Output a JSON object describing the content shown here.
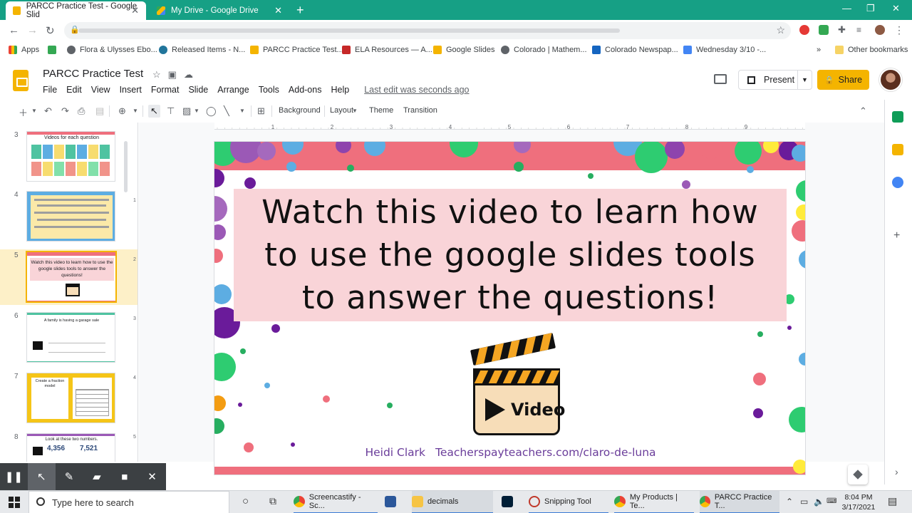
{
  "browser": {
    "tabs": [
      {
        "label": "PARCC Practice Test - Google Slid",
        "active": true
      },
      {
        "label": "My Drive - Google Drive",
        "active": false
      }
    ],
    "bookmarks": [
      "Apps",
      "Flora & Ulysses Ebo...",
      "Released Items - N...",
      "PARCC Practice Test...",
      "ELA Resources — A...",
      "Google Slides",
      "Colorado | Mathem...",
      "Colorado Newspap...",
      "Wednesday 3/10 -...",
      "Other bookmarks"
    ],
    "bookmarks_more": "»"
  },
  "app": {
    "title": "PARCC Practice Test",
    "menu": [
      "File",
      "Edit",
      "View",
      "Insert",
      "Format",
      "Slide",
      "Arrange",
      "Tools",
      "Add-ons",
      "Help"
    ],
    "last_edit": "Last edit was seconds ago",
    "present_label": "Present",
    "share_label": "Share"
  },
  "toolbar": {
    "background": "Background",
    "layout": "Layout",
    "theme": "Theme",
    "transition": "Transition"
  },
  "filmstrip": {
    "slides": [
      {
        "number": "3",
        "caption": "Videos for each question"
      },
      {
        "number": "4",
        "caption": ""
      },
      {
        "number": "5",
        "caption": "Watch this video to learn how to use the google slides tools to answer the questions!"
      },
      {
        "number": "6",
        "caption": "A family is having a garage sale"
      },
      {
        "number": "7",
        "caption": "Create a fraction model"
      },
      {
        "number": "8",
        "caption": "Look at these two numbers."
      }
    ],
    "slide8_numbers": [
      "4,356",
      "7,521"
    ],
    "selected": "5"
  },
  "ruler": {
    "marks": [
      "1",
      "2",
      "3",
      "4",
      "5",
      "6",
      "7",
      "8",
      "9"
    ],
    "vmarks": [
      "1",
      "2",
      "3",
      "4",
      "5"
    ]
  },
  "slide": {
    "title": "Watch this video to learn how to use the google slides tools to answer the questions!",
    "video_label": "Video",
    "author": "Heidi Clark",
    "site": "Teacherspayteachers.com/claro-de-luna"
  },
  "taskbar": {
    "search_placeholder": "Type here to search",
    "apps": [
      "Screencastify - Sc...",
      "decimals",
      "Snipping Tool",
      "My Products | Te...",
      "PARCC Practice T..."
    ],
    "time": "8:04 PM",
    "date": "3/17/2021"
  },
  "colors": {
    "accent": "#f4b400",
    "tabstrip": "#16a085",
    "slide_band": "#ef6f7d",
    "title_box": "#f9d4d8",
    "credit": "#6a3d9a"
  }
}
